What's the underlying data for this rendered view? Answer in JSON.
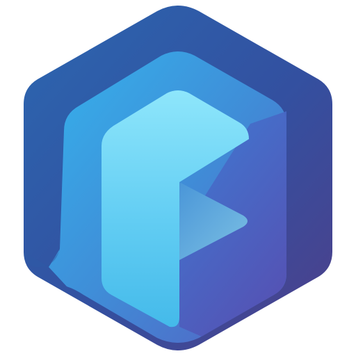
{
  "logo": {
    "name": "app-logo",
    "colors": {
      "background": "#ffffff",
      "hex_outer_top": "#2A63A8",
      "hex_outer_bottom": "#4D4089",
      "mid_layer_top": "#3BA8E6",
      "mid_layer_bottom": "#5566C4",
      "front_top": "#8EE4FA",
      "front_bottom": "#46BCEB",
      "triangle_top": "#4A98D8",
      "triangle_bottom": "#6FB8E0"
    },
    "icon": "hexagon-p-play-logo"
  }
}
